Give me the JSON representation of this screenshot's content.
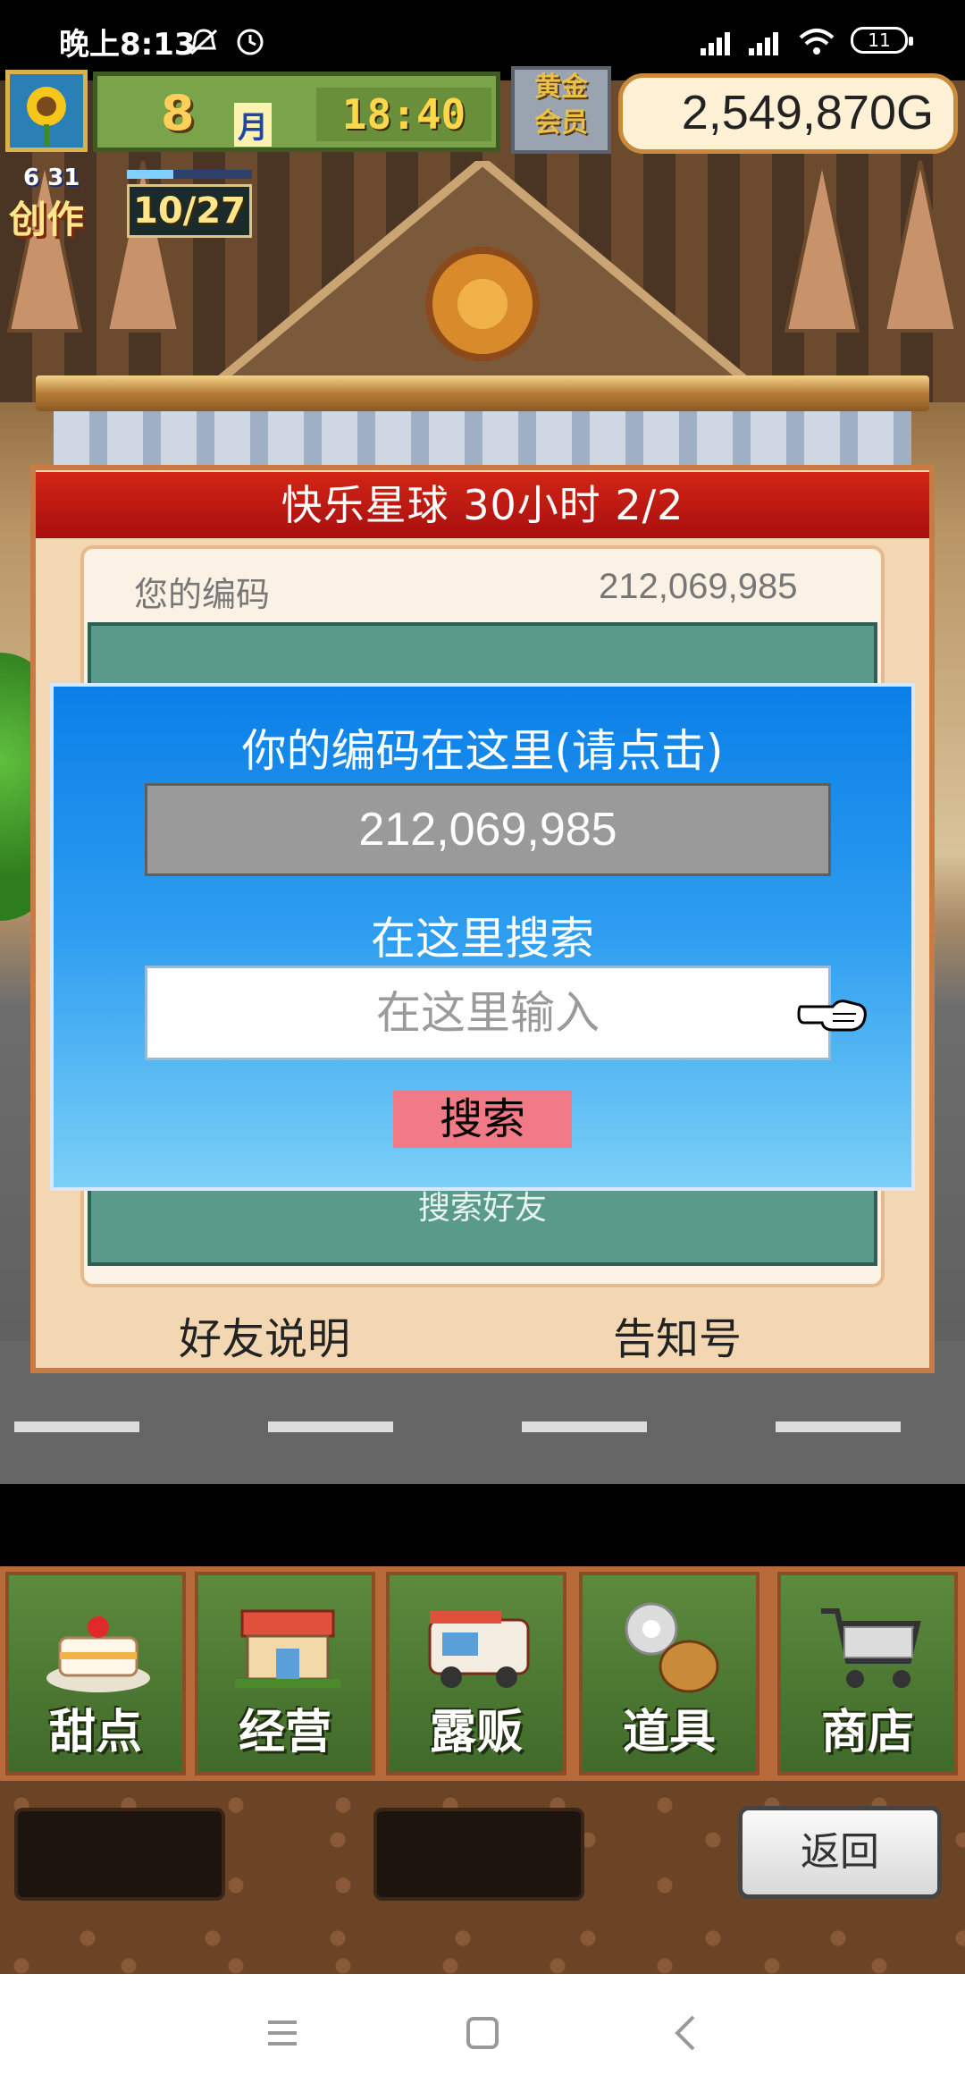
{
  "status_bar": {
    "time": "晚上8:13",
    "battery": "11"
  },
  "hud": {
    "month_number": "8",
    "month_unit": "月",
    "clock": "18:40",
    "gold_badge_line1": "黄金",
    "gold_badge_line2": "会员",
    "money": "2,549,870G",
    "create_date": "6 31",
    "create_label": "创作",
    "create_progress": "10/27",
    "create_progress_fraction": 0.37
  },
  "panel": {
    "title": "快乐星球  30小时 2/2",
    "your_code_label": "您的编码",
    "your_code_value": "212,069,985",
    "search_friend_label": "搜索好友",
    "friend_explain_button": "好友说明",
    "notice_button": "告知号"
  },
  "popup": {
    "title": "你的编码在这里(请点击)",
    "code": "212,069,985",
    "search_here": "在这里搜索",
    "input_placeholder": "在这里输入",
    "search_button": "搜索"
  },
  "menu": {
    "items": [
      {
        "label": "甜点",
        "icon": "cake-icon"
      },
      {
        "label": "经营",
        "icon": "shop-icon"
      },
      {
        "label": "露贩",
        "icon": "food-truck-icon"
      },
      {
        "label": "道具",
        "icon": "items-icon"
      },
      {
        "label": "商店",
        "icon": "cart-icon"
      }
    ]
  },
  "back_button": "返回"
}
